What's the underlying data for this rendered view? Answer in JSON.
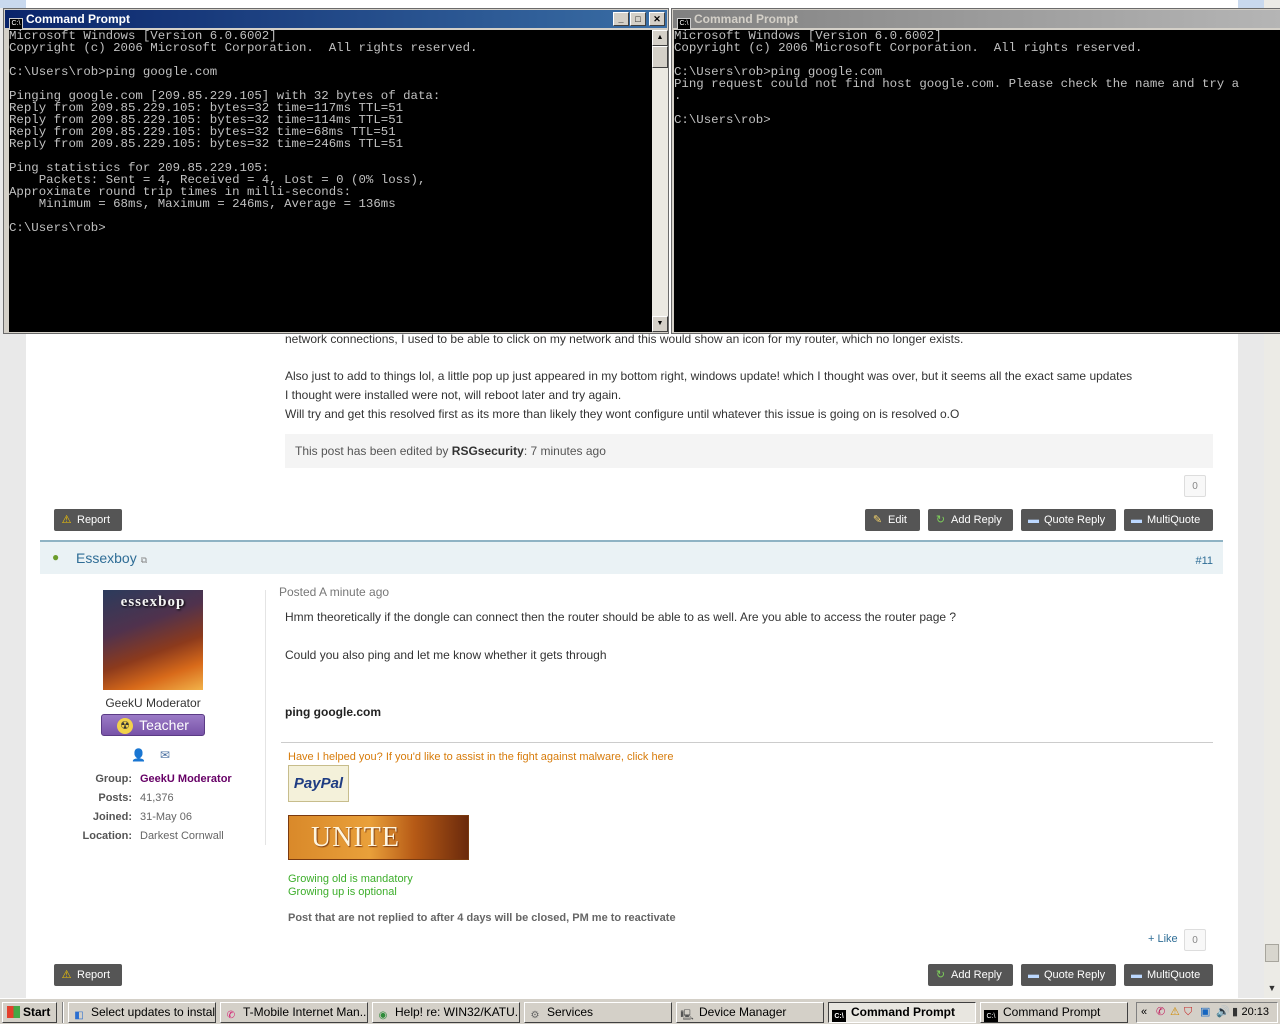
{
  "forum": {
    "post_partial": {
      "line1": "network connections, I used to be able to click on my network and this would show an icon for my router, which no longer exists.",
      "line2": "Also just to add to things lol, a little pop up just appeared in my bottom right, windows update! which I thought was over, but it seems all the exact same updates",
      "line3": "I thought were installed were not, will reboot later and try again.",
      "line4": "Will try and get this resolved first as its more than likely they wont configure until whatever this issue is going on is resolved o.O",
      "edited_prefix": "This post has been edited by",
      "edited_by": "RSGsecurity",
      "edited_suffix": ": 7 minutes ago",
      "like_count": "0",
      "buttons": {
        "report": "Report",
        "edit": "Edit",
        "add_reply": "Add Reply",
        "quote_reply": "Quote Reply",
        "multi_quote": "MultiQuote"
      }
    },
    "post11": {
      "author": "Essexboy",
      "post_number": "#11",
      "posted": "Posted A minute ago",
      "avatar_text": "essexbop",
      "user_title": "GeekU Moderator",
      "badge": "Teacher",
      "stats": {
        "group_label": "Group:",
        "group": "GeekU Moderator",
        "posts_label": "Posts:",
        "posts": "41,376",
        "joined_label": "Joined:",
        "joined": "31-May 06",
        "location_label": "Location:",
        "location": "Darkest Cornwall"
      },
      "body1": "Hmm theoretically if the dongle can connect then the router should be able to as well. Are you able to access the router page ?",
      "body2": "Could you also ping and let me know whether it gets through",
      "command": "ping google.com",
      "signature": {
        "help_text": "Have I helped you? If you'd like to assist in the fight against malware, click here",
        "paypal": "PayPal",
        "unite": "UNITE",
        "line1": "Growing old is mandatory",
        "line2": "Growing up is optional",
        "notice": "Post that are not replied to after 4 days will be closed, PM me to reactivate"
      },
      "like_link": "+ Like",
      "like_count": "0",
      "buttons": {
        "report": "Report",
        "add_reply": "Add Reply",
        "quote_reply": "Quote Reply",
        "multi_quote": "MultiQuote"
      }
    }
  },
  "cmd1": {
    "title": "Command Prompt",
    "lines": [
      "Microsoft Windows [Version 6.0.6002]",
      "Copyright (c) 2006 Microsoft Corporation.  All rights reserved.",
      "",
      "C:\\Users\\rob>ping google.com",
      "",
      "Pinging google.com [209.85.229.105] with 32 bytes of data:",
      "Reply from 209.85.229.105: bytes=32 time=117ms TTL=51",
      "Reply from 209.85.229.105: bytes=32 time=114ms TTL=51",
      "Reply from 209.85.229.105: bytes=32 time=68ms TTL=51",
      "Reply from 209.85.229.105: bytes=32 time=246ms TTL=51",
      "",
      "Ping statistics for 209.85.229.105:",
      "    Packets: Sent = 4, Received = 4, Lost = 0 (0% loss),",
      "Approximate round trip times in milli-seconds:",
      "    Minimum = 68ms, Maximum = 246ms, Average = 136ms",
      "",
      "C:\\Users\\rob>"
    ]
  },
  "cmd2": {
    "title": "Command Prompt",
    "lines": [
      "Microsoft Windows [Version 6.0.6002]",
      "Copyright (c) 2006 Microsoft Corporation.  All rights reserved.",
      "",
      "C:\\Users\\rob>ping google.com",
      "Ping request could not find host google.com. Please check the name and try a",
      ".",
      "",
      "C:\\Users\\rob>"
    ]
  },
  "taskbar": {
    "start": "Start",
    "tasks": [
      {
        "label": "Select updates to install",
        "icon": "windows-update-icon"
      },
      {
        "label": "T-Mobile Internet Man...",
        "icon": "tmobile-icon"
      },
      {
        "label": "Help! re: WIN32/KATU...",
        "icon": "chrome-icon"
      },
      {
        "label": "Services",
        "icon": "services-icon"
      },
      {
        "label": "Device Manager",
        "icon": "device-manager-icon"
      },
      {
        "label": "Command Prompt",
        "icon": "cmd-icon"
      },
      {
        "label": "Command Prompt",
        "icon": "cmd-icon"
      }
    ],
    "clock": "20:13",
    "tray_chevron": "«"
  }
}
